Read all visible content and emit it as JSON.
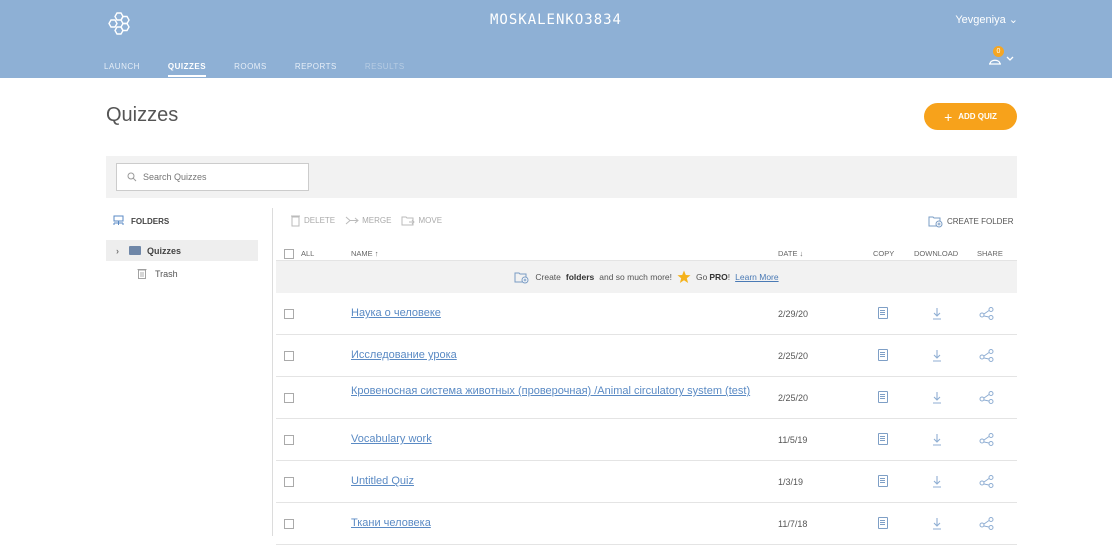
{
  "header": {
    "room_name": "MOSKALENKO3834",
    "user_name": "Yevgeniya",
    "user_chevron": "⌄",
    "notification_count": "0",
    "nav": [
      {
        "label": "LAUNCH"
      },
      {
        "label": "QUIZZES"
      },
      {
        "label": "ROOMS"
      },
      {
        "label": "REPORTS"
      },
      {
        "label": "RESULTS"
      }
    ]
  },
  "page": {
    "title": "Quizzes",
    "add_quiz_label": "ADD QUIZ",
    "add_quiz_plus": "+"
  },
  "search": {
    "placeholder": "Search Quizzes"
  },
  "sidebar": {
    "folders_label": "FOLDERS",
    "items": [
      {
        "label": "Quizzes"
      },
      {
        "label": "Trash"
      }
    ]
  },
  "toolbar": {
    "delete_label": "DELETE",
    "merge_label": "MERGE",
    "move_label": "MOVE",
    "create_folder_label": "CREATE FOLDER"
  },
  "table": {
    "headers": {
      "all": "ALL",
      "name": "NAME ↑",
      "date": "DATE ↓",
      "copy": "COPY",
      "download": "DOWNLOAD",
      "share": "SHARE"
    },
    "promo": {
      "text_1": "Create",
      "bold_1": "folders",
      "text_2": "and so much more!",
      "text_3": "Go",
      "bold_2": "PRO",
      "text_4": "!",
      "link": "Learn More"
    },
    "rows": [
      {
        "name": "Наука о человеке",
        "date": "2/29/20"
      },
      {
        "name": "Исследование урока",
        "date": "2/25/20"
      },
      {
        "name": "Кровеносная система животных (проверочная) /Animal circulatory system (test)",
        "date": "2/25/20"
      },
      {
        "name": "Vocabulary work",
        "date": "11/5/19"
      },
      {
        "name": "Untitled Quiz",
        "date": "1/3/19"
      },
      {
        "name": "Ткани человека",
        "date": "11/7/18"
      }
    ]
  },
  "colors": {
    "header_bg": "#8eb0d5",
    "accent_orange": "#f7a21b",
    "link_blue": "#5a8ac4"
  }
}
